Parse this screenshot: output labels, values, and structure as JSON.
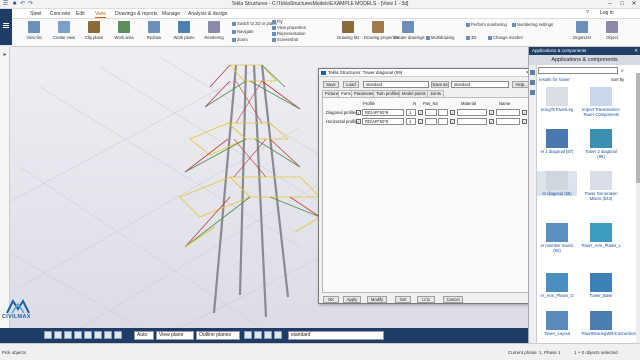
{
  "window": {
    "title": "Tekla Structures - C:\\TeklaStructuresModels\\EXAMPLE MODELS - [View 1 - 3d]",
    "quick_access": [
      "☰",
      "■",
      "↶",
      "↷"
    ],
    "controls": [
      "–",
      "□",
      "✕"
    ]
  },
  "menu": {
    "items": [
      "Steel",
      "Concrete",
      "Edit",
      "View",
      "Drawings & reports",
      "Manage",
      "Analysis & design"
    ],
    "active": "View",
    "right_items": [
      "?",
      "Log in"
    ]
  },
  "ribbon": {
    "buttons": [
      {
        "label": "View list",
        "color": "#6b8fb8"
      },
      {
        "label": "Create view",
        "color": "#7a9fc8"
      },
      {
        "label": "Clip plane",
        "color": "#8a6a3a"
      },
      {
        "label": "Work area",
        "color": "#5b8f5b"
      },
      {
        "label": "Redraw",
        "color": "#6b8fb8"
      },
      {
        "label": "Work plane",
        "color": "#4f7faf"
      },
      {
        "label": "Rendering",
        "color": "#8a8aa8"
      }
    ],
    "small_items": [
      "Switch to 2D or plane",
      "Navigate",
      "Fly",
      "Zoom",
      "Fit",
      "View properties",
      "Representation",
      "Screenshot"
    ],
    "buttons2": [
      {
        "label": "Drawing list",
        "color": "#8a6a3a"
      },
      {
        "label": "Drawing properties",
        "color": "#a07a4a"
      },
      {
        "label": "Create drawings",
        "color": "#6b8fb8"
      },
      {
        "label": "Multidrawing",
        "color": "#5b7faf"
      }
    ],
    "small_items2": [
      "Perform numbering",
      "Numbering settings",
      "3D",
      "Change number",
      "Organizer",
      "Object"
    ]
  },
  "dialog": {
    "title": "Tekla Structures: Tower diagonal (59)",
    "save_label": "Save",
    "load_label": "Load",
    "load_value": "standard",
    "save_as_label": "Save as",
    "save_as_value": "standard",
    "help_label": "Help...",
    "tabs": [
      "Picture",
      "Parts",
      "Parameters",
      "Twin profiles",
      "Model points",
      "Joints"
    ],
    "active_tab": "Parts",
    "columns": {
      "profile": "Profile",
      "n": "N",
      "pos_no": "Pos_No",
      "material": "Material",
      "name": "Name"
    },
    "rows": [
      {
        "label": "Diagonal profiles",
        "profile": "RD/AR*50*6",
        "n": "1"
      },
      {
        "label": "Horizontal profiles",
        "profile": "RD/AR*50*6",
        "n": "1"
      }
    ],
    "footer": [
      "OK",
      "Apply",
      "Modify",
      "Get",
      "☐/☑",
      "Cancel"
    ]
  },
  "panel": {
    "title": "Applications & components",
    "heading": "Applications & components",
    "search_placeholder": "",
    "results_label": "results for 'tower'",
    "sort_label": "Sort by",
    "items": [
      {
        "label": "ecingToTowerLeg",
        "color": "#d8dde6"
      },
      {
        "label": "Import Transmission Tower Components",
        "color": "#c8d7ea"
      },
      {
        "label": "er 1 diagonal (87)",
        "color": "#4a78b0"
      },
      {
        "label": "Tower 2 diagonal (88)",
        "color": "#3b8fb0"
      },
      {
        "label": "er diagonal (59)",
        "color": "#cfd6de"
      },
      {
        "label": "Tower Generation Macro (543)",
        "color": "#d8dde6"
      },
      {
        "label": "er member macro (60)",
        "color": "#5b8fc0"
      },
      {
        "label": "Tower_Arm_Plates_L",
        "color": "#3d9ac0"
      },
      {
        "label": "er_Arm_Plates_G",
        "color": "#4a8fc0"
      },
      {
        "label": "Tower_Base",
        "color": "#3b82b8"
      },
      {
        "label": "Tower_Layout",
        "color": "#5a8ab8"
      },
      {
        "label": "TowerBracingWithConnection",
        "color": "#4a7fb0"
      }
    ],
    "show_hidden": "Show hidden items"
  },
  "bottombar": {
    "filter": "standard",
    "mode": "Auto",
    "plane": "View plane",
    "outline": "Outline planes"
  },
  "status": {
    "left": "Pick objects",
    "right": "Current phase: 1, Phase 1",
    "selected": "1 + 0 objects selected"
  },
  "brand": {
    "text": "CIVILMAX",
    "color": "#1f5fa8"
  },
  "colors": {
    "accent": "#c06000",
    "panel_title": "#1f3f66",
    "tower_grey": "#8a8a92",
    "tower_yellow": "#e6c62e",
    "tower_red": "#c0403a",
    "tower_green": "#4f8f4f"
  }
}
